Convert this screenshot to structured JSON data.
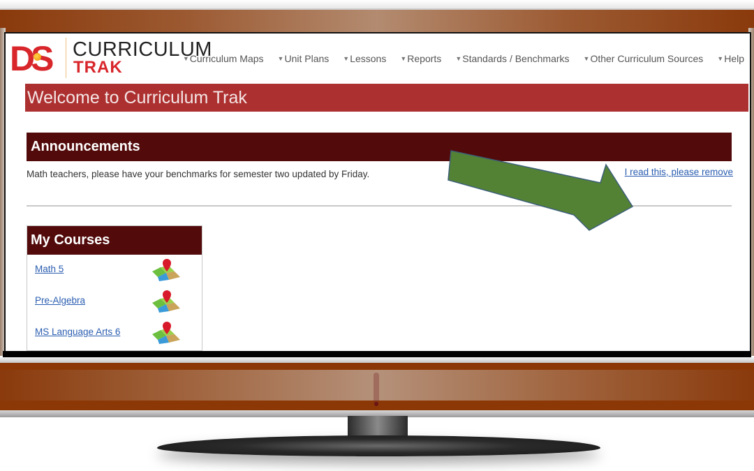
{
  "app": {
    "logo": {
      "mark": "DS",
      "line1": "CURRICULUM",
      "line2": "TRAK"
    },
    "nav": [
      {
        "label": "Curriculum Maps"
      },
      {
        "label": "Unit Plans"
      },
      {
        "label": "Lessons"
      },
      {
        "label": "Reports"
      },
      {
        "label": "Standards / Benchmarks"
      },
      {
        "label": "Other Curriculum Sources"
      },
      {
        "label": "Help"
      }
    ],
    "nav_caret": "▼",
    "welcome_title": "Welcome to Curriculum Trak"
  },
  "announcements": {
    "title": "Announcements",
    "items": [
      {
        "text": "Math teachers, please have your benchmarks for semester two updated by Friday.",
        "remove_label": "I read this, please remove"
      }
    ]
  },
  "my_courses": {
    "title": "My Courses",
    "items": [
      {
        "name": "Math 5",
        "icon": "curriculum-map-icon"
      },
      {
        "name": "Pre-Algebra",
        "icon": "curriculum-map-icon"
      },
      {
        "name": "MS Language Arts 6",
        "icon": "curriculum-map-icon"
      }
    ]
  },
  "annotation": {
    "type": "arrow",
    "color": "#548235",
    "points_to": "remove-announcement-link"
  },
  "colors": {
    "brand_red": "#d8262b",
    "welcome_bar": "#ad3030",
    "section_header": "#520a0a",
    "link": "#2a5db0",
    "bezel": "#8c3806"
  }
}
